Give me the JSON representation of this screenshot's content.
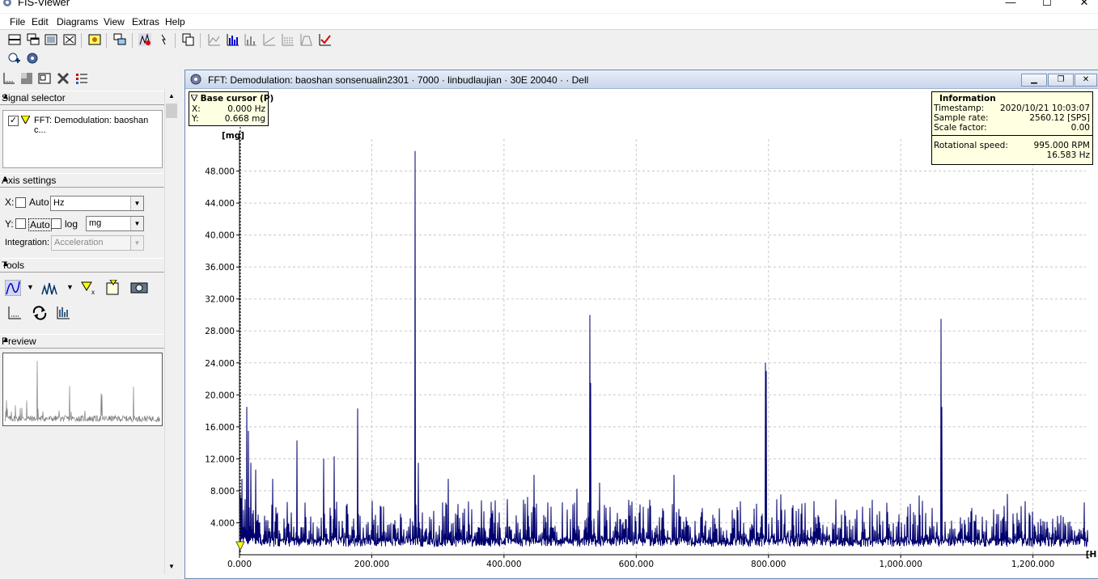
{
  "window": {
    "title": "FIS-Viewer",
    "minimize": "—",
    "maximize": "☐",
    "close": "✕"
  },
  "menu": [
    "File",
    "Edit",
    "Diagrams",
    "View",
    "Extras",
    "Help"
  ],
  "sidebar": {
    "signal_selector": {
      "title": "Signal selector",
      "items": [
        {
          "label": "FFT: Demodulation: baoshan c...",
          "checked": true
        }
      ]
    },
    "axis_settings": {
      "title": "Axis settings",
      "x_label": "X:",
      "x_auto": "Auto",
      "x_unit": "Hz",
      "y_label": "Y:",
      "y_auto": "Auto",
      "y_log": "log",
      "y_unit": "mg",
      "integration_label": "Integration:",
      "integration_value": "Acceleration"
    },
    "tools": {
      "title": "Tools"
    },
    "preview": {
      "title": "Preview"
    }
  },
  "mdi": {
    "title": "FFT: Demodulation: baoshan sonsenualin2301 · 7000 · linbudlaujian · 30E 20040 · · Dell",
    "cursor_box": {
      "title": "Base cursor (P)",
      "x_label": "X:",
      "x_value": "0.000 Hz",
      "y_label": "Y:",
      "y_value": "0.668 mg"
    },
    "info_box": {
      "title": "Information",
      "timestamp_label": "Timestamp:",
      "timestamp_value": "2020/10/21 10:03:07",
      "sample_rate_label": "Sample rate:",
      "sample_rate_value": "2560.12 [SPS]",
      "scale_factor_label": "Scale factor:",
      "scale_factor_value": "0.00",
      "rot_speed_label": "Rotational speed:",
      "rot_speed_rpm": "995.000 RPM",
      "rot_speed_hz": "16.583 Hz"
    }
  },
  "colors": {
    "trace": "#00006e",
    "grid": "#c8c8c8",
    "info_bg": "#ffffe1"
  },
  "chart_data": {
    "type": "line",
    "xlabel": "[Hz]",
    "ylabel": "[mg]",
    "xlim": [
      0,
      1280
    ],
    "ylim": [
      0,
      52
    ],
    "x_ticks": [
      "0.000",
      "200.000",
      "400.000",
      "600.000",
      "800.000",
      "1,000.000",
      "1,200.000"
    ],
    "y_ticks": [
      "4.000",
      "8.000",
      "12.000",
      "16.000",
      "20.000",
      "24.000",
      "28.000",
      "32.000",
      "36.000",
      "40.000",
      "44.000",
      "48.000"
    ],
    "grid": true,
    "noise_floor_mg": [
      1,
      6
    ],
    "peaks": [
      {
        "x": 4,
        "y": 9.5
      },
      {
        "x": 11,
        "y": 18.5
      },
      {
        "x": 13,
        "y": 15.5
      },
      {
        "x": 17,
        "y": 11.5
      },
      {
        "x": 50,
        "y": 9.5
      },
      {
        "x": 87,
        "y": 14.3
      },
      {
        "x": 127,
        "y": 12.0
      },
      {
        "x": 143,
        "y": 12.3
      },
      {
        "x": 179,
        "y": 18.3
      },
      {
        "x": 265,
        "y": 50.5
      },
      {
        "x": 266,
        "y": 40.0
      },
      {
        "x": 270,
        "y": 11.5
      },
      {
        "x": 316,
        "y": 9.5
      },
      {
        "x": 445,
        "y": 10.0
      },
      {
        "x": 530,
        "y": 30.0
      },
      {
        "x": 531,
        "y": 21.5
      },
      {
        "x": 545,
        "y": 9.0
      },
      {
        "x": 657,
        "y": 10.0
      },
      {
        "x": 796,
        "y": 24.0
      },
      {
        "x": 797,
        "y": 23.0
      },
      {
        "x": 1061,
        "y": 29.5
      },
      {
        "x": 1062,
        "y": 18.5
      }
    ]
  }
}
